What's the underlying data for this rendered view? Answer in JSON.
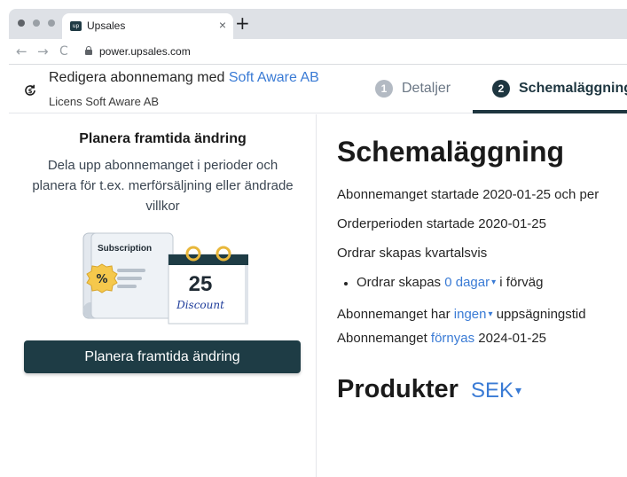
{
  "browser": {
    "tab_title": "Upsales",
    "tab_favicon_text": "up",
    "tab_close": "×",
    "new_tab": "+",
    "url": "power.upsales.com",
    "nav": {
      "back": "←",
      "forward": "→",
      "reload": "C"
    }
  },
  "header": {
    "title_prefix": "Redigera abonnemang med",
    "company_link": "Soft Aware AB",
    "subtitle": "Licens Soft Aware AB",
    "steps": [
      {
        "number": "1",
        "label": "Detaljer",
        "active": false
      },
      {
        "number": "2",
        "label": "Schemaläggning",
        "active": true
      }
    ]
  },
  "left_panel": {
    "title": "Planera framtida ändring",
    "description": "Dela upp abonnemanget i perioder och planera för t.ex. merförsäljning eller ändrade villkor",
    "illustration": {
      "card_label": "Subscription",
      "badge_symbol": "%",
      "calendar_day": "25",
      "calendar_text": "Discount"
    },
    "button_label": "Planera framtida ändring"
  },
  "schedule": {
    "title": "Schemaläggning",
    "started": "Abonnemanget startade 2020-01-25 och per",
    "order_period": "Orderperioden startade 2020-01-25",
    "frequency": "Ordrar skapas kvartalsvis",
    "advance_prefix": "Ordrar skapas",
    "advance_link": "0 dagar",
    "advance_suffix": "i förväg",
    "notice_prefix": "Abonnemanget har",
    "notice_link": "ingen",
    "notice_suffix": "uppsägningstid",
    "renew_prefix": "Abonnemanget",
    "renew_link": "förnyas",
    "renew_suffix": "2024-01-25"
  },
  "products": {
    "title": "Produkter",
    "currency": "SEK"
  },
  "colors": {
    "accent_dark": "#1e3c45",
    "link": "#3a7bd5",
    "badge_yellow": "#f5c84c",
    "ring_gold": "#e8b73a"
  }
}
